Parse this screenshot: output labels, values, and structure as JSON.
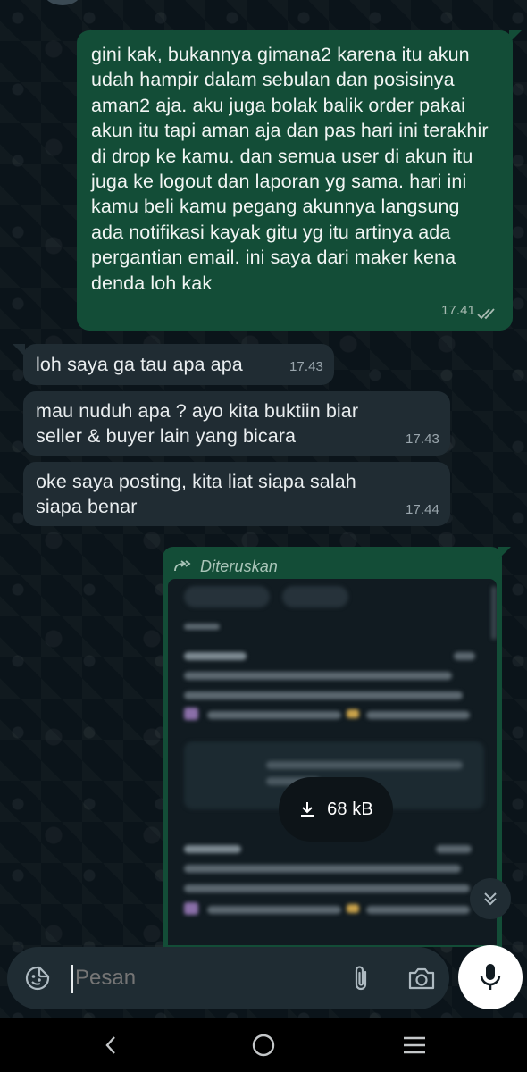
{
  "messages": [
    {
      "direction": "outgoing",
      "text": "gini kak, bukannya gimana2 karena itu akun udah hampir dalam sebulan dan posisinya aman2 aja. aku juga bolak balik order pakai akun itu tapi aman aja dan pas hari ini terakhir di drop ke kamu. dan semua user di akun itu juga ke logout dan laporan yg sama. hari ini kamu beli kamu pegang akunnya langsung ada notifikasi kayak gitu yg itu artinya ada pergantian email. ini saya dari maker kena denda loh kak",
      "time": "17.41",
      "status_icon": "double-check-read-icon"
    },
    {
      "direction": "incoming",
      "text": "loh saya ga tau apa apa",
      "time": "17.43"
    },
    {
      "direction": "incoming",
      "text": "mau nuduh apa ? ayo kita buktiin biar seller & buyer lain yang bicara",
      "time": "17.43"
    },
    {
      "direction": "incoming",
      "text": "oke saya posting, kita liat siapa salah siapa benar",
      "time": "17.44"
    }
  ],
  "forwarded": {
    "label": "Diteruskan",
    "label_icon": "forward-arrow-icon",
    "download_size": "68 kB",
    "download_icon": "download-icon"
  },
  "composer": {
    "placeholder": "Pesan",
    "emoji_icon": "sticker-icon",
    "attach_icon": "paperclip-icon",
    "camera_icon": "camera-icon",
    "mic_icon": "mic-icon"
  },
  "scroll_down_icon": "double-chevron-down-icon",
  "navbar": [
    "back-icon",
    "home-icon",
    "recents-icon"
  ],
  "colors": {
    "outgoing_bubble": "#134d37",
    "incoming_bubble": "#202c33",
    "background": "#0b141a",
    "read_ticks": "#a8bbb2"
  }
}
